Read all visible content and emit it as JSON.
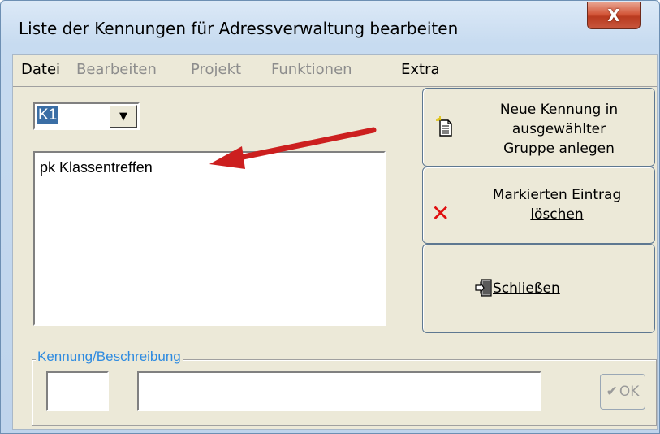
{
  "window": {
    "title": "Liste der Kennungen für Adressverwaltung bearbeiten",
    "close_label": "X"
  },
  "menu": {
    "items": [
      {
        "label": "Datei",
        "enabled": true
      },
      {
        "label": "Bearbeiten",
        "enabled": false
      },
      {
        "label": "Projekt",
        "enabled": false
      },
      {
        "label": "Funktionen",
        "enabled": false
      },
      {
        "label": "Extra",
        "enabled": true
      }
    ]
  },
  "group_select": {
    "value": "K1"
  },
  "list": {
    "items": [
      "pk  Klassentreffen"
    ]
  },
  "buttons": {
    "new": {
      "line1": "Neue Kennung in",
      "line2": "ausgewählter",
      "line3": "Gruppe anlegen",
      "icon": "new-document-icon"
    },
    "delete": {
      "line1": "Markierten Eintrag",
      "line2": "löschen",
      "icon": "red-x-icon"
    },
    "close": {
      "label": "Schließen",
      "icon": "exit-door-icon"
    }
  },
  "detail": {
    "group_label": "Kennung/Beschreibung",
    "code_value": "",
    "description_value": "",
    "ok_label": "OK"
  },
  "colors": {
    "accent_label": "#2f8be0",
    "selection": "#3a6ea5",
    "arrow": "#cc1f1f",
    "close_button": "#c8462a"
  }
}
